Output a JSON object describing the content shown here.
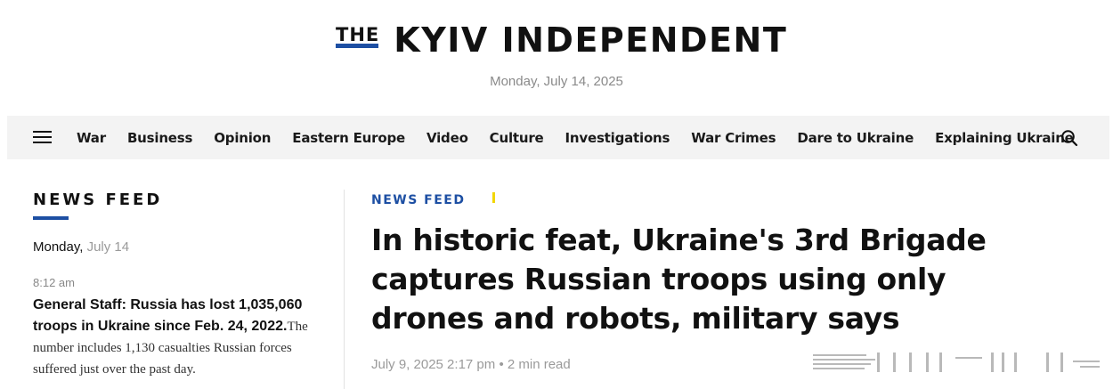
{
  "brand": {
    "the": "THE",
    "name": "KYIV INDEPENDENT",
    "accent_color": "#1d4fa3",
    "highlight_color": "#f2d600"
  },
  "date_line": "Monday, July 14, 2025",
  "nav": {
    "menu_icon": "hamburger-menu-icon",
    "items": [
      "War",
      "Business",
      "Opinion",
      "Eastern Europe",
      "Video",
      "Culture",
      "Investigations",
      "War Crimes",
      "Dare to Ukraine",
      "Explaining Ukraine"
    ],
    "search_icon": "search-icon"
  },
  "sidebar": {
    "title": "NEWS FEED",
    "day_label": "Monday,",
    "day_date": "July 14",
    "items": [
      {
        "time": "8:12 am",
        "headline": "General Staff: Russia has lost 1,035,060 troops in Ukraine since Feb. 24, 2022.",
        "summary": "The number includes 1,130 casualties Russian forces suffered just over the past day."
      }
    ]
  },
  "article": {
    "kicker": "NEWS FEED",
    "headline": "In historic feat, Ukraine's 3rd Brigade captures Russian troops using only drones and robots, military says",
    "date": "July 9, 2025 2:17 pm",
    "separator": "•",
    "read_time": "2 min read"
  }
}
